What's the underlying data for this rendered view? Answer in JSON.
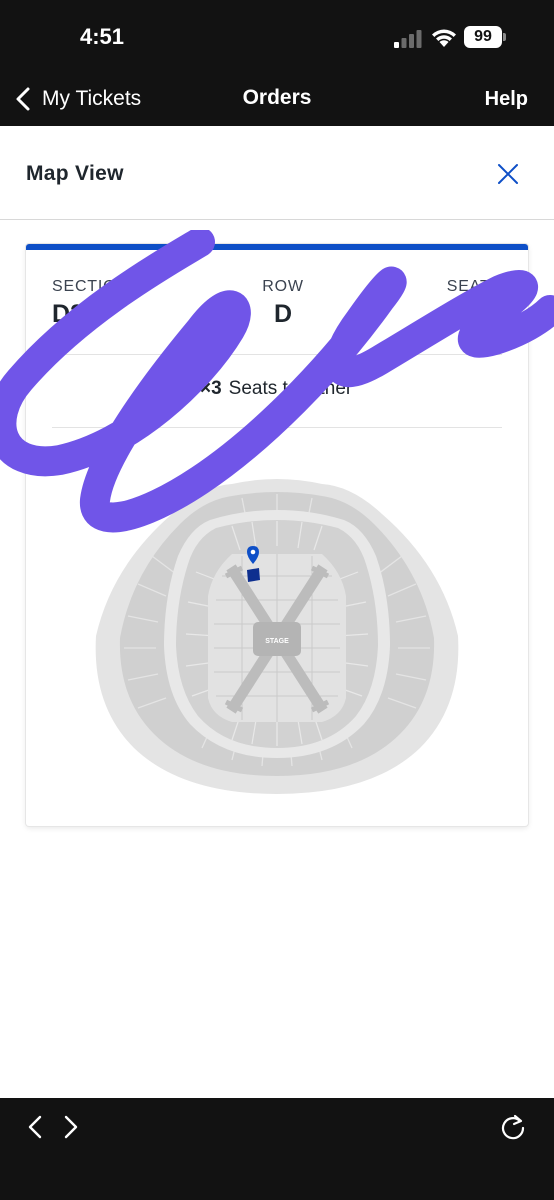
{
  "status_bar": {
    "time": "4:51",
    "battery": "99"
  },
  "nav": {
    "back_label": "My Tickets",
    "title": "Orders",
    "help": "Help"
  },
  "modal": {
    "title": "Map View"
  },
  "ticket": {
    "section_label": "SECTIO",
    "section_value": "D2",
    "row_label": "ROW",
    "row_value": "D",
    "seats_label": "SEATS",
    "seats_value": "1",
    "together_count": "×3",
    "together_text": "Seats together"
  },
  "map": {
    "stage_label": "STAGE"
  },
  "colors": {
    "accent": "#0e4fc7",
    "scribble": "#7055e8",
    "bar": "#121212"
  },
  "icons": [
    "chevron-left-icon",
    "close-icon",
    "seat-icon",
    "location-pin-icon",
    "back-arrow-icon",
    "forward-arrow-icon",
    "reload-icon"
  ]
}
